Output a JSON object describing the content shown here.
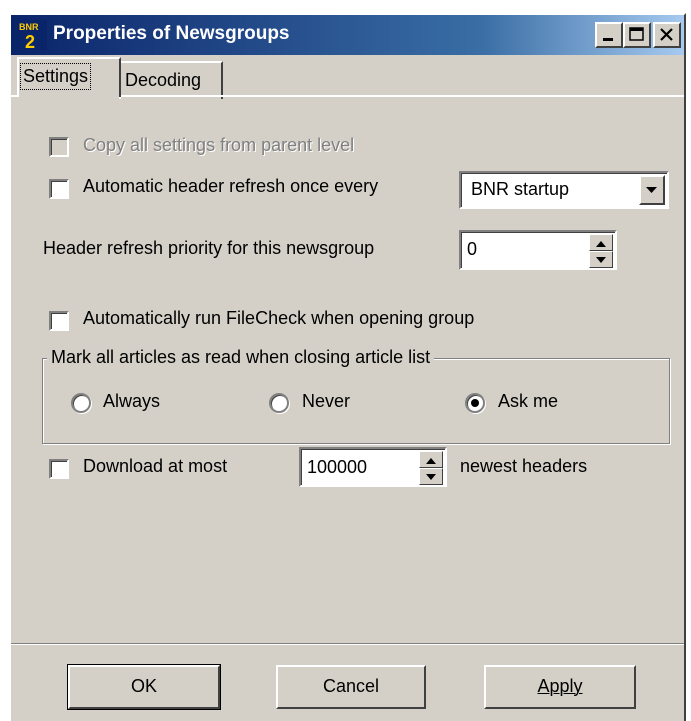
{
  "window": {
    "title": "Properties of Newsgroups",
    "app_icon": "bnr2-app-icon",
    "controls": [
      "minimize-icon",
      "maximize-icon",
      "close-icon"
    ]
  },
  "tabs": [
    {
      "label": "Settings",
      "active": true
    },
    {
      "label": "Decoding",
      "active": false
    }
  ],
  "settings": {
    "copy_all": {
      "label": "Copy all settings from parent level",
      "checked": false,
      "enabled": false
    },
    "auto_refresh": {
      "label": "Automatic header refresh once every",
      "checked": false
    },
    "refresh_interval": {
      "selected": "BNR startup"
    },
    "priority": {
      "label": "Header refresh priority for this newsgroup",
      "value": "0"
    },
    "filecheck": {
      "label": "Automatically run FileCheck when opening group",
      "checked": false
    },
    "mark_read": {
      "label": "Mark all articles as read when closing article list",
      "options": [
        "Always",
        "Never",
        "Ask me"
      ],
      "selected": "Ask me"
    },
    "download": {
      "label": "Download at most",
      "checked": false,
      "value": "100000",
      "suffix": "newest headers"
    }
  },
  "buttons": {
    "ok": "OK",
    "cancel": "Cancel",
    "apply": "Apply"
  }
}
